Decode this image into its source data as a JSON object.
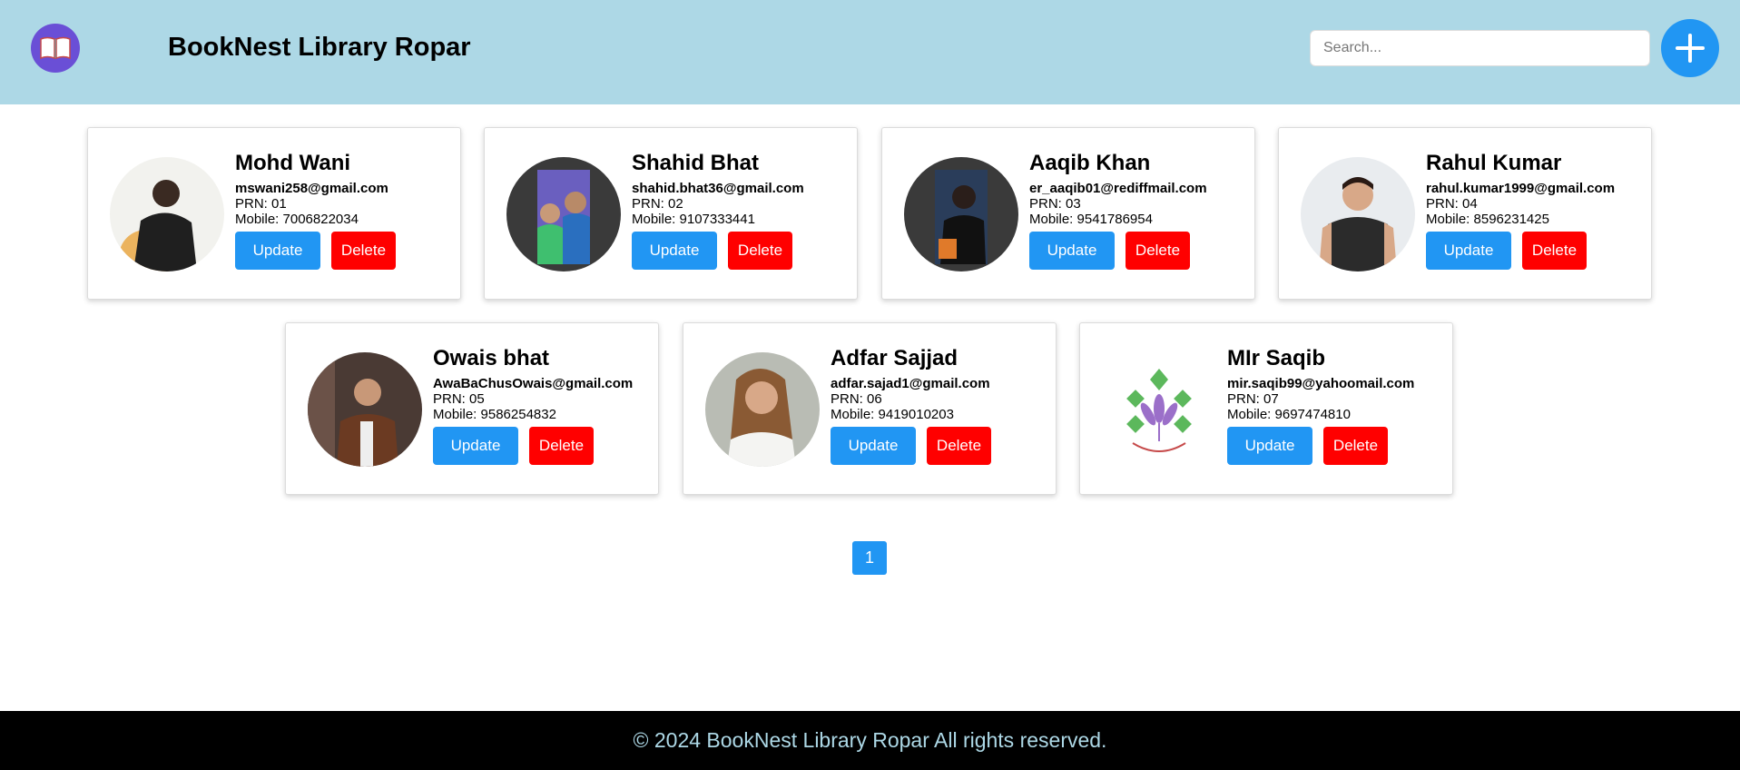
{
  "header": {
    "logo_icon": "open-book-icon",
    "title": "BookNest Library Ropar",
    "search_placeholder": "Search...",
    "add_icon": "plus-icon",
    "background": "#add8e6"
  },
  "colors": {
    "primary": "#2196f3",
    "danger": "#ff0000",
    "logo": "#6a4fd6"
  },
  "members": [
    {
      "name": "Mohd Wani",
      "email": "mswani258@gmail.com",
      "prn": "PRN: 01",
      "mobile": "Mobile: 7006822034",
      "update_label": "Update",
      "delete_label": "Delete",
      "avatar": "person-photo"
    },
    {
      "name": "Shahid Bhat",
      "email": "shahid.bhat36@gmail.com",
      "prn": "PRN: 02",
      "mobile": "Mobile: 9107333441",
      "update_label": "Update",
      "delete_label": "Delete",
      "avatar": "person-photo"
    },
    {
      "name": "Aaqib Khan",
      "email": "er_aaqib01@rediffmail.com",
      "prn": "PRN: 03",
      "mobile": "Mobile: 9541786954",
      "update_label": "Update",
      "delete_label": "Delete",
      "avatar": "person-photo"
    },
    {
      "name": "Rahul Kumar",
      "email": "rahul.kumar1999@gmail.com",
      "prn": "PRN: 04",
      "mobile": "Mobile: 8596231425",
      "update_label": "Update",
      "delete_label": "Delete",
      "avatar": "person-photo"
    },
    {
      "name": "Owais bhat",
      "email": "AwaBaChusOwais@gmail.com",
      "prn": "PRN: 05",
      "mobile": "Mobile: 9586254832",
      "update_label": "Update",
      "delete_label": "Delete",
      "avatar": "person-photo"
    },
    {
      "name": "Adfar Sajjad",
      "email": "adfar.sajad1@gmail.com",
      "prn": "PRN: 06",
      "mobile": "Mobile: 9419010203",
      "update_label": "Update",
      "delete_label": "Delete",
      "avatar": "person-photo"
    },
    {
      "name": "MIr Saqib",
      "email": "mir.saqib99@yahoomail.com",
      "prn": "PRN: 07",
      "mobile": "Mobile: 9697474810",
      "update_label": "Update",
      "delete_label": "Delete",
      "avatar": "knowledge-logo"
    }
  ],
  "pagination": {
    "current": "1"
  },
  "footer": {
    "text": "© 2024 BookNest Library Ropar All rights reserved."
  }
}
